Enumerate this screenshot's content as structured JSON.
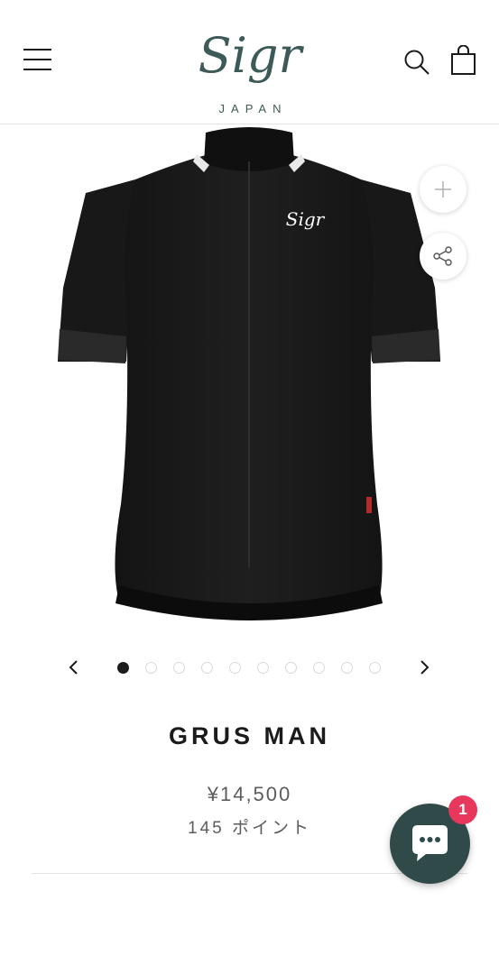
{
  "header": {
    "brand_script": "Sigr",
    "brand_sub": "JAPAN",
    "icons": {
      "menu": "hamburger-menu-icon",
      "search": "search-icon",
      "cart": "shopping-bag-icon"
    }
  },
  "gallery": {
    "image_alt": "GRUS MAN jersey",
    "jersey_logo": "Sigr",
    "dot_count": 10,
    "active_dot": 1,
    "icons": {
      "zoom": "plus-icon",
      "share": "share-icon",
      "prev": "chevron-left-icon",
      "next": "chevron-right-icon"
    }
  },
  "product": {
    "title": "GRUS MAN",
    "price": "¥14,500",
    "points": "145 ポイント"
  },
  "chat": {
    "badge_count": "1",
    "icon": "chat-bubble-icon"
  },
  "colors": {
    "brand": "#3c5a57",
    "chat_bg": "#2f4a49",
    "badge": "#e8375c",
    "text": "#1c1b1b"
  }
}
